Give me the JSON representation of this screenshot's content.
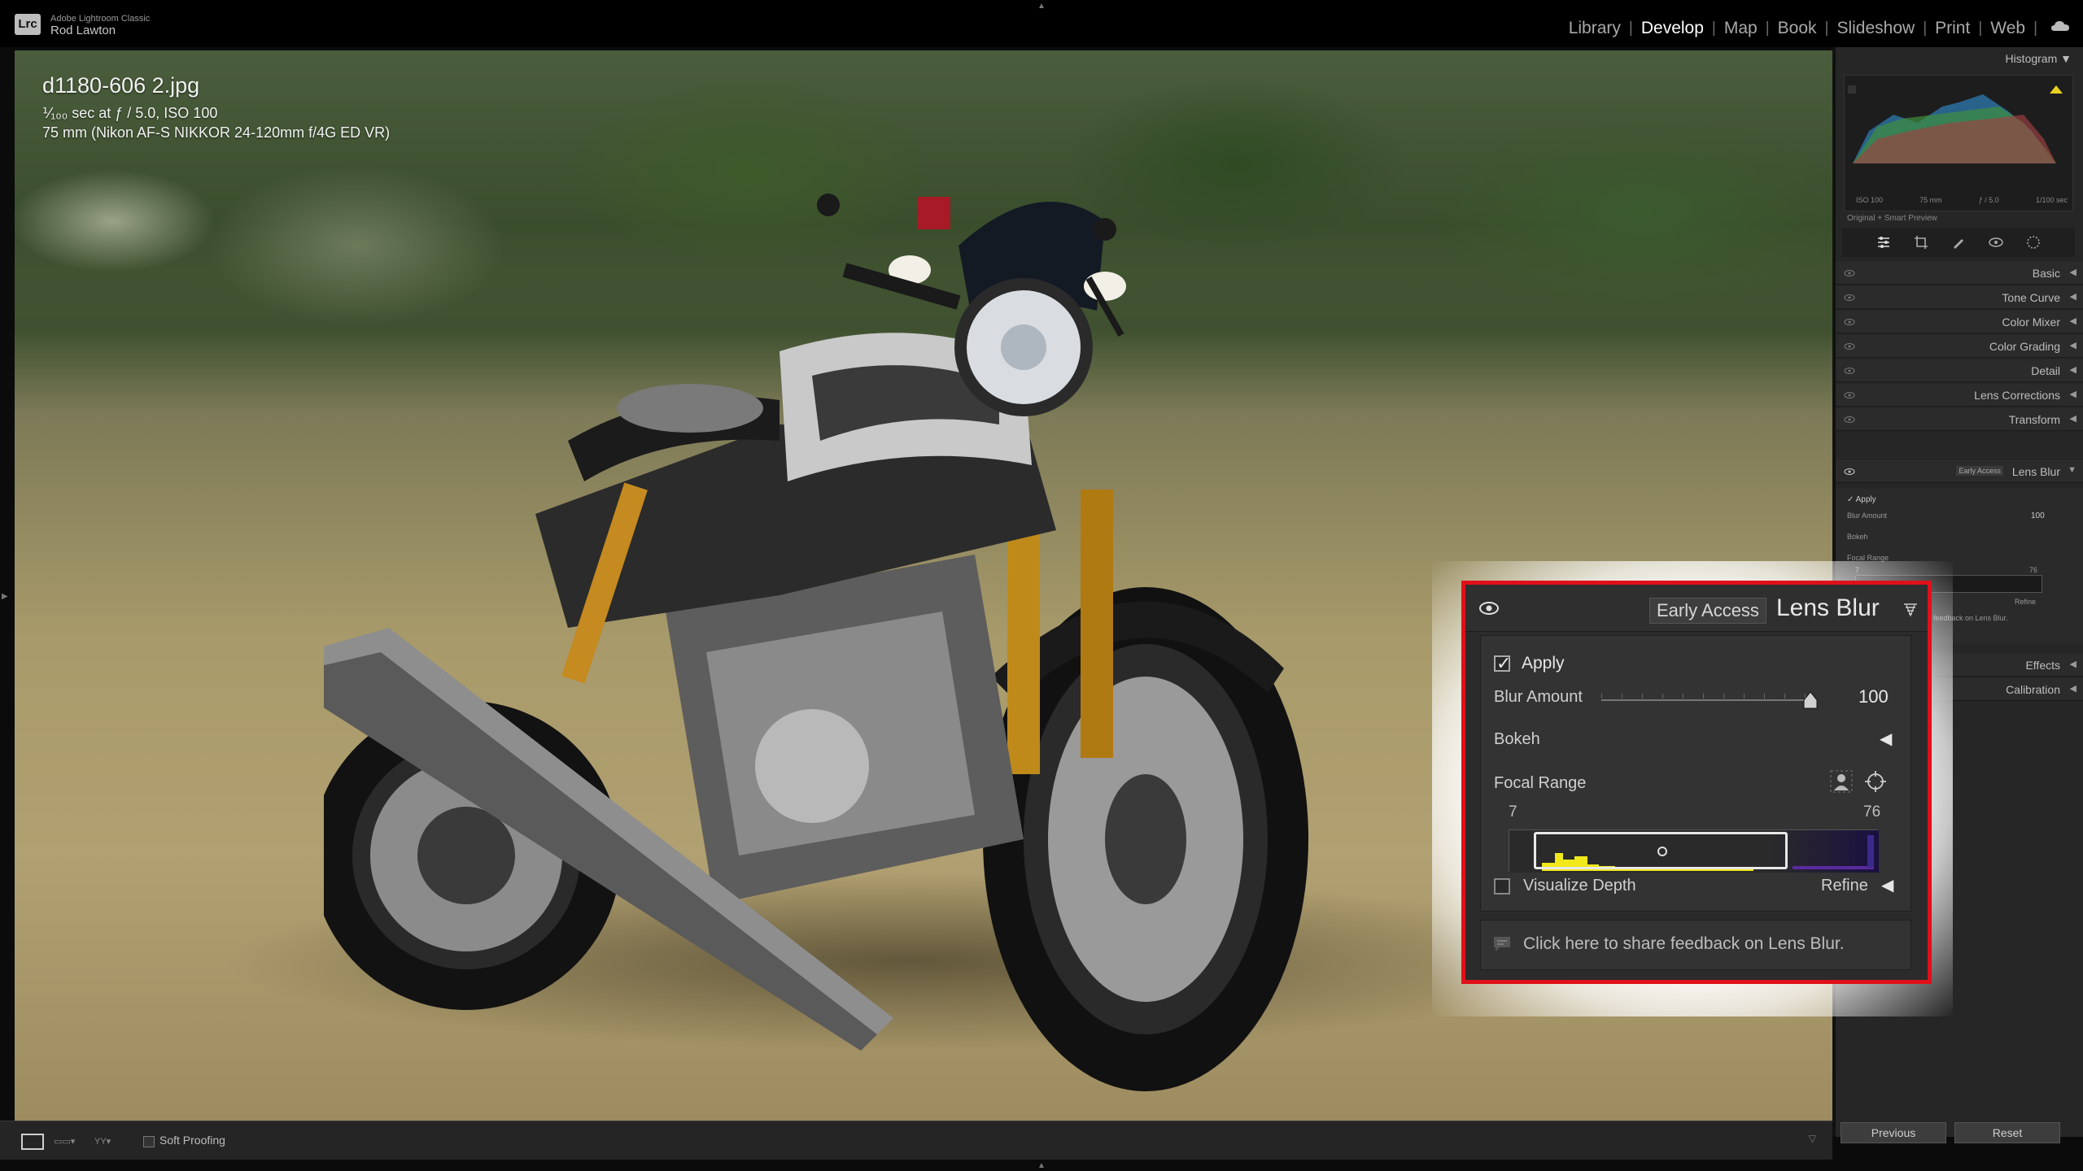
{
  "app": {
    "name": "Adobe Lightroom Classic",
    "logo": "Lrc",
    "user": "Rod Lawton"
  },
  "modules": [
    {
      "label": "Library",
      "active": false
    },
    {
      "label": "Develop",
      "active": true
    },
    {
      "label": "Map",
      "active": false
    },
    {
      "label": "Book",
      "active": false
    },
    {
      "label": "Slideshow",
      "active": false
    },
    {
      "label": "Print",
      "active": false
    },
    {
      "label": "Web",
      "active": false
    }
  ],
  "photo": {
    "filename": "d1180-606 2.jpg",
    "exposure_prefix": "⅟₁₀₀ sec at ƒ / 5.0, ISO 100",
    "lens": "75 mm (Nikon AF-S NIKKOR 24-120mm f/4G ED VR)"
  },
  "histogram": {
    "title": "Histogram",
    "meta": [
      "ISO 100",
      "75 mm",
      "ƒ / 5.0",
      "1/100 sec"
    ],
    "preview": "Original + Smart Preview"
  },
  "panels": [
    {
      "label": "Basic"
    },
    {
      "label": "Tone Curve"
    },
    {
      "label": "Color Mixer"
    },
    {
      "label": "Color Grading"
    },
    {
      "label": "Detail"
    },
    {
      "label": "Lens Corrections"
    },
    {
      "label": "Transform"
    }
  ],
  "lens_blur": {
    "badge": "Early Access",
    "title": "Lens Blur",
    "apply_label": "Apply",
    "apply_checked": true,
    "blur_amount_label": "Blur Amount",
    "blur_amount_value": "100",
    "blur_amount": 100,
    "bokeh_label": "Bokeh",
    "focal_range_label": "Focal Range",
    "range_min": "7",
    "range_max": "76",
    "visualize_label": "Visualize Depth",
    "refine_label": "Refine",
    "feedback_text": "Click here to share feedback on Lens Blur.",
    "feedback_short": "feedback on Lens Blur."
  },
  "panels_after": [
    {
      "label": "Effects"
    },
    {
      "label": "Calibration"
    }
  ],
  "buttons": {
    "previous": "Previous",
    "reset": "Reset"
  },
  "toolbar": {
    "soft_proofing": "Soft Proofing"
  },
  "colors": {
    "accent_red": "#e0101a",
    "active_module": "#ffffff",
    "depth_yellow": "#f0e81a",
    "depth_purple": "#5a2aa0"
  }
}
